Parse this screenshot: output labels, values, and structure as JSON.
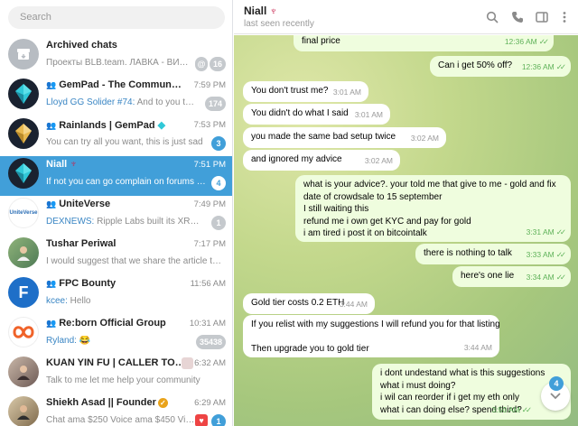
{
  "search": {
    "placeholder": "Search"
  },
  "chats": [
    {
      "title": "Archived chats",
      "preview": "Проекты BLB.team. ЛАВКА - ВИТ...",
      "time": "",
      "badge": "16",
      "badge_prefix": "@",
      "avatar_icon": "archive-icon"
    },
    {
      "title": "GemPad - The Community's Lau...",
      "sender": "Lloyd GG Solider #74:",
      "preview": " And to you too C...",
      "time": "7:59 PM",
      "badge": "174",
      "avatar_icon": "gem-logo",
      "group": true
    },
    {
      "title": "Rainlands | GemPad",
      "preview": "You can try all you want, this is just sad",
      "time": "7:53 PM",
      "badge": "3",
      "avatar_icon": "gem-logo",
      "group": true
    },
    {
      "title": "Niall",
      "preview": "If not you can go complain on forums an...",
      "time": "7:51 PM",
      "badge": "4",
      "avatar_icon": "gem-logo",
      "active": true
    },
    {
      "title": "UniteVerse",
      "sender": "DEXNEWS:",
      "preview": " Ripple Labs built its XRP toke...",
      "time": "7:49 PM",
      "badge": "1",
      "avatar_icon": "uniteverse-logo",
      "group": true
    },
    {
      "title": "Tushar Periwal",
      "preview": "I would suggest that we share the article thro...",
      "time": "7:17 PM",
      "badge": "",
      "avatar_icon": "user-photo"
    },
    {
      "title": "FPC Bounty",
      "sender": "kcee:",
      "preview": " Hello",
      "time": "11:56 AM",
      "badge": "",
      "avatar_icon": "fpc-logo",
      "group": true
    },
    {
      "title": "Re:born Official Group",
      "sender": "Ryland:",
      "preview": " 😂",
      "time": "10:31 AM",
      "badge": "35438",
      "avatar_icon": "reborn-logo",
      "group": true
    },
    {
      "title": "KUAN YIN FU | CALLER TO HEA...",
      "preview": "Talk to me let me help your community",
      "time": "6:32 AM",
      "badge": "",
      "avatar_icon": "user-photo"
    },
    {
      "title": "Shiekh Asad || Founder",
      "preview": "Chat ama $250  Voice ama $450 Video...",
      "time": "6:29 AM",
      "badge": "1",
      "avatar_icon": "user-photo",
      "verified": true
    }
  ],
  "header": {
    "name": "Niall",
    "status": "last seen recently"
  },
  "messages": [
    {
      "dir": "out",
      "lines": [
        "final price"
      ],
      "time": "12:36 AM",
      "ticks": true
    },
    {
      "dir": "out",
      "lines": [
        "Can i get 50% off?"
      ],
      "time": "12:36 AM",
      "ticks": true
    },
    {
      "dir": "in",
      "lines": [
        "You don't trust me?"
      ],
      "time": "3:01 AM"
    },
    {
      "dir": "in",
      "lines": [
        "You didn't do what I said"
      ],
      "time": "3:01 AM"
    },
    {
      "dir": "in",
      "lines": [
        "you made the same bad setup twice"
      ],
      "time": "3:02 AM"
    },
    {
      "dir": "in",
      "lines": [
        "and ignored my advice"
      ],
      "time": "3:02 AM"
    },
    {
      "dir": "out",
      "lines": [
        "what is your advice?. your told me that give to me - gold and fix",
        "date of crowdsale to 15 september",
        "I still  waiting this",
        "refund me i own get KYC and pay for gold",
        "i am tired i post it on bitcointalk"
      ],
      "time": "3:31 AM",
      "ticks": true
    },
    {
      "dir": "out",
      "lines": [
        "there is nothing to talk"
      ],
      "time": "3:33 AM",
      "ticks": true
    },
    {
      "dir": "out",
      "lines": [
        "here's one lie"
      ],
      "time": "3:34 AM",
      "ticks": true
    },
    {
      "dir": "in",
      "lines": [
        "Gold tier costs 0.2 ETH"
      ],
      "time": "3:44 AM"
    },
    {
      "dir": "in",
      "lines": [
        "If you relist with my suggestions I will refund you for that listing",
        "",
        "Then upgrade you to gold tier"
      ],
      "time": "3:44 AM"
    },
    {
      "dir": "out",
      "lines": [
        "i dont undestand what is this suggestions",
        "what i must doing?",
        "i wil can reorder if i get my eth only",
        "what i can doing else? spend third?"
      ],
      "time": "3:50 AM",
      "ticks": true
    }
  ],
  "scroll_unread": "4",
  "colors": {
    "accent": "#419fd9",
    "out_bubble": "#effdde",
    "in_bubble": "#ffffff",
    "tick": "#5fb259"
  }
}
